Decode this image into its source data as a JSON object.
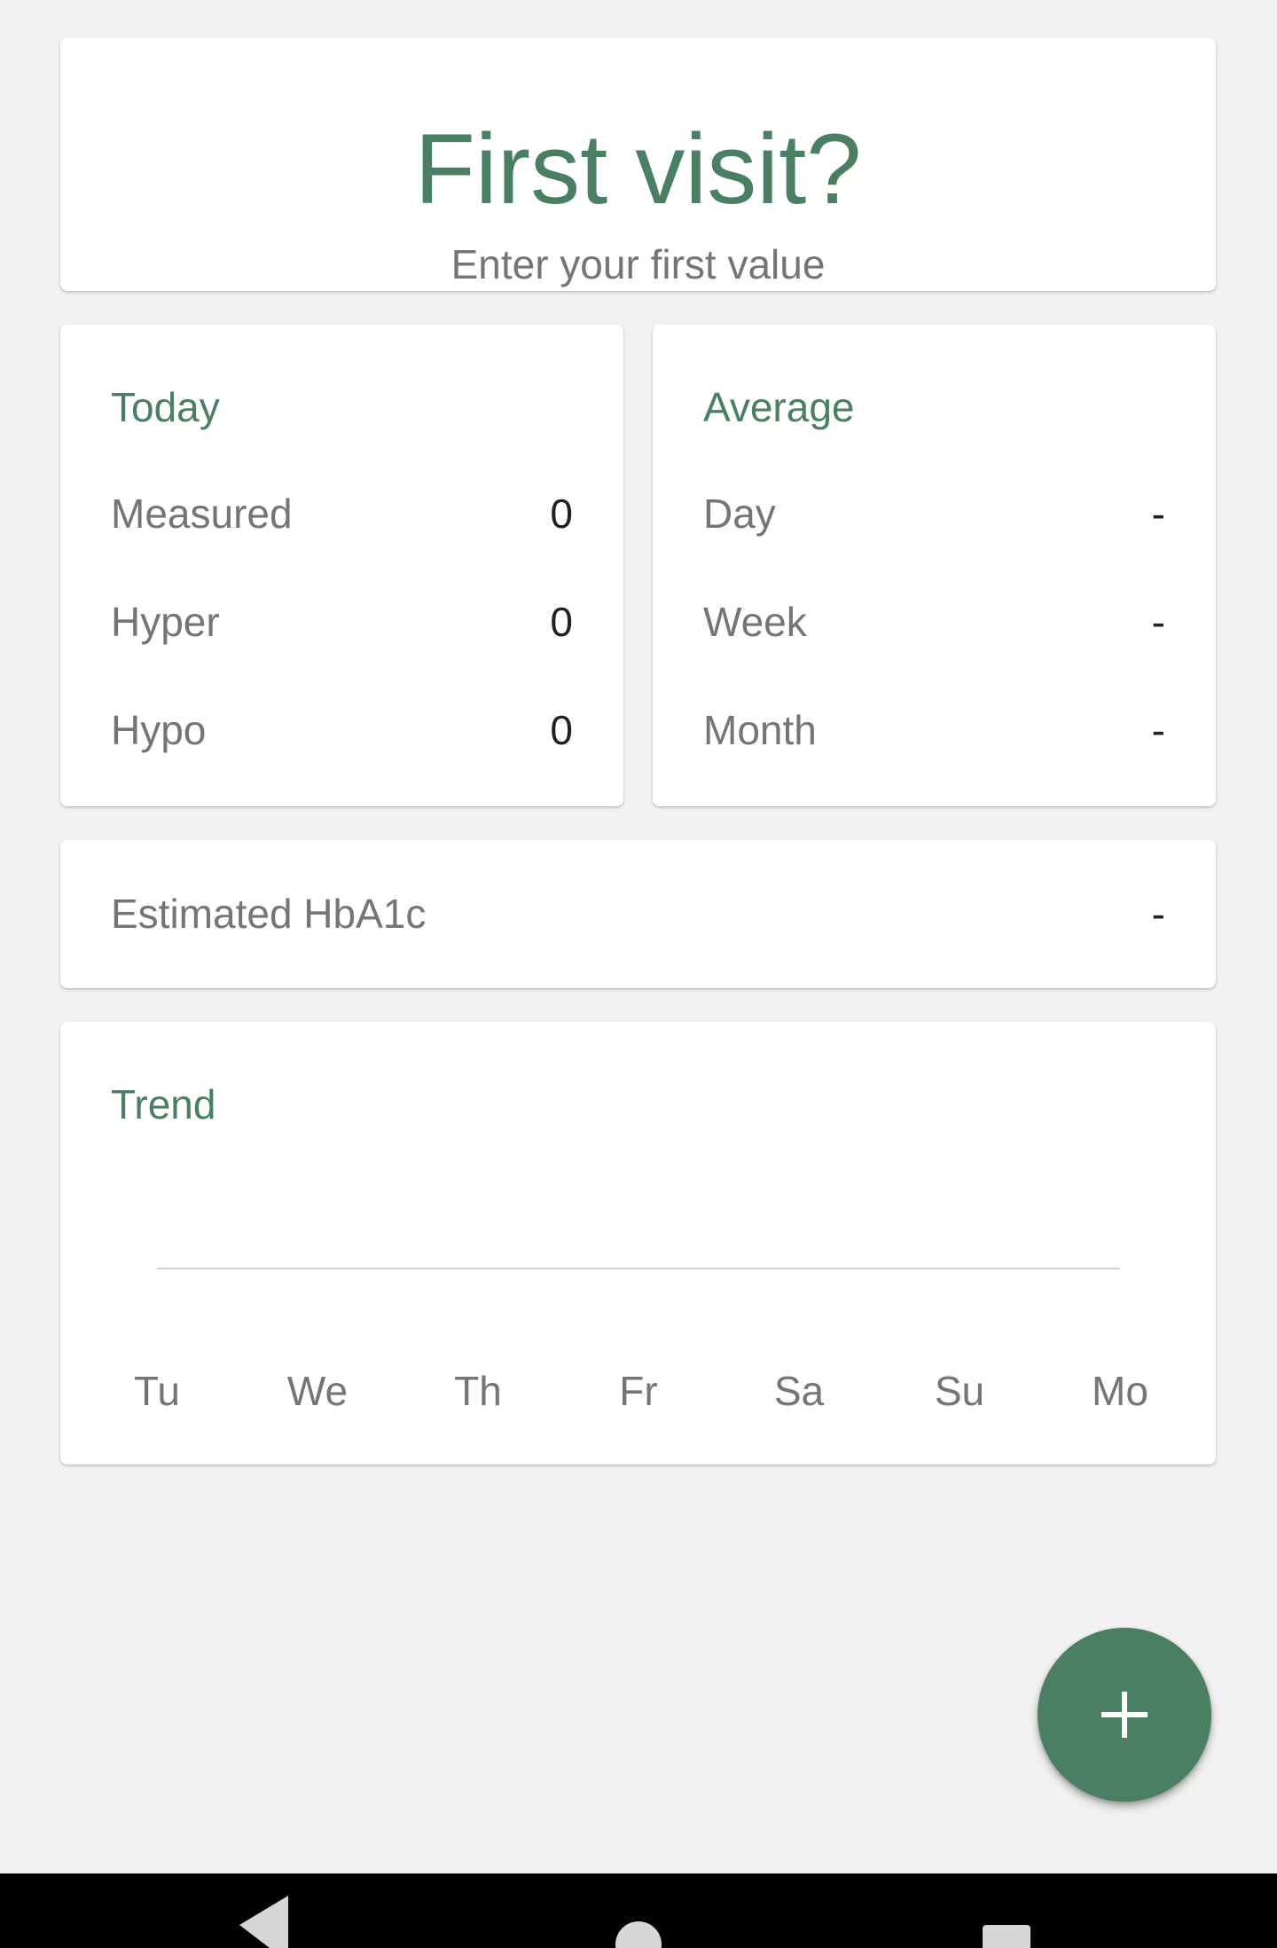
{
  "welcome": {
    "title": "First visit?",
    "subtitle": "Enter your first value"
  },
  "today": {
    "heading": "Today",
    "rows": [
      {
        "label": "Measured",
        "value": "0"
      },
      {
        "label": "Hyper",
        "value": "0"
      },
      {
        "label": "Hypo",
        "value": "0"
      }
    ]
  },
  "average": {
    "heading": "Average",
    "rows": [
      {
        "label": "Day",
        "value": "-"
      },
      {
        "label": "Week",
        "value": "-"
      },
      {
        "label": "Month",
        "value": "-"
      }
    ]
  },
  "hba1c": {
    "label": "Estimated HbA1c",
    "value": "-"
  },
  "trend": {
    "heading": "Trend"
  },
  "chart_data": {
    "type": "line",
    "title": "Trend",
    "categories": [
      "Tu",
      "We",
      "Th",
      "Fr",
      "Sa",
      "Su",
      "Mo"
    ],
    "series": [],
    "xlabel": "",
    "ylabel": "",
    "grid": false
  },
  "fab": {
    "icon": "plus-icon"
  },
  "navbar": {
    "back_icon": "back-triangle-icon",
    "home_icon": "home-circle-icon",
    "recents_icon": "recents-square-icon"
  },
  "colors": {
    "accent": "#4a7f63",
    "background": "#f2f2f2",
    "card": "#ffffff",
    "label_text": "#757575",
    "value_text": "#212121"
  }
}
